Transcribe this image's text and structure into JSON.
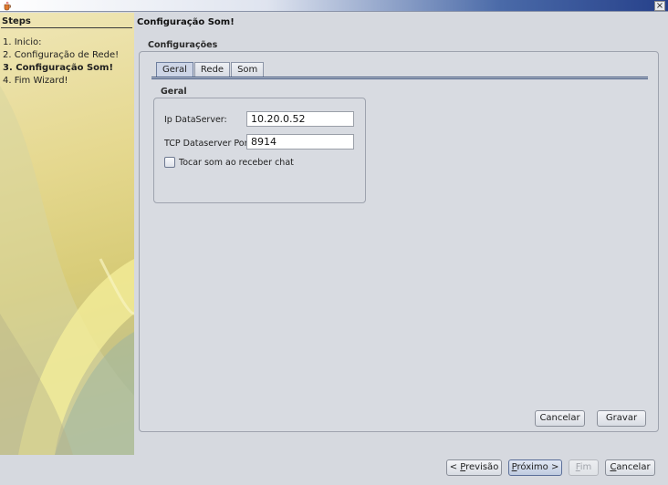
{
  "window": {
    "close_glyph": "×"
  },
  "sidebar": {
    "title": "Steps",
    "items": [
      {
        "label": "1. Inicio:",
        "active": false
      },
      {
        "label": "2. Configuração de Rede!",
        "active": false
      },
      {
        "label": "3. Configuração Som!",
        "active": true
      },
      {
        "label": "4. Fim Wizard!",
        "active": false
      }
    ]
  },
  "page": {
    "title": "Configuração Som!"
  },
  "configuracoes": {
    "legend": "Configurações",
    "tabs": [
      {
        "label": "Geral",
        "active": true
      },
      {
        "label": "Rede",
        "active": false
      },
      {
        "label": "Som",
        "active": false
      }
    ],
    "geral": {
      "legend": "Geral",
      "ip_label": "Ip DataServer:",
      "ip_value": "10.20.0.52",
      "port_label": "TCP Dataserver Port:",
      "port_value": "8914",
      "chat_label": "Tocar som ao receber chat",
      "chat_checked": false
    },
    "buttons": {
      "cancel": "Cancelar",
      "save": "Gravar"
    }
  },
  "wizard_buttons": {
    "prev": {
      "mnemonic_pre": "< ",
      "mnemonic": "P",
      "rest": "revisão"
    },
    "next": {
      "mnemonic": "P",
      "rest": "róximo >"
    },
    "finish": {
      "mnemonic": "F",
      "rest": "im",
      "disabled": true
    },
    "cancel": {
      "mnemonic": "C",
      "rest": "ancelar"
    }
  }
}
